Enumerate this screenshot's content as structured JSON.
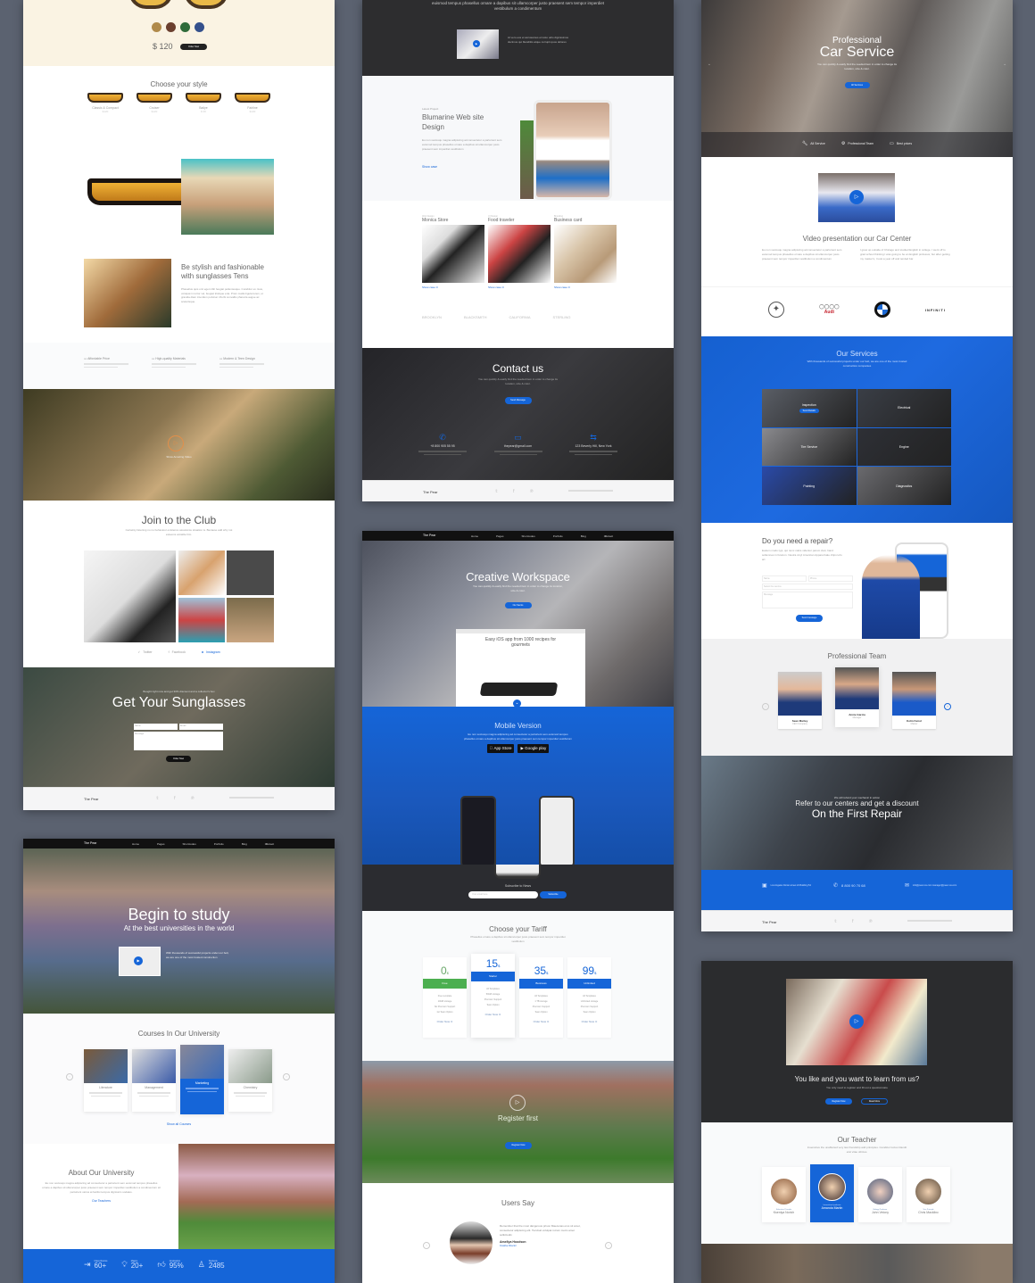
{
  "brand": "The Pear",
  "nav_items": [
    "Home",
    "Pages",
    "Shortcodes",
    "Portfolio",
    "Blog",
    "Contact"
  ],
  "sunglasses": {
    "swatch_colors": [
      "#b08a4a",
      "#6b3f2e",
      "#2f6b3a",
      "#34508c"
    ],
    "price": "$ 120",
    "order_btn": "Order Now",
    "choose_title": "Choose your style",
    "styles": [
      {
        "name": "Classic & Compact",
        "price": "$120"
      },
      {
        "name": "Cruiser",
        "price": "$120"
      },
      {
        "name": "Bailye",
        "price": "$ 95"
      },
      {
        "name": "Fairline",
        "price": "$130"
      }
    ],
    "feature_title": "Be stylish and fashionable with sunglasses Tens",
    "feature_text": "Phasellus quis orci eget nibh feugiat pellentesque. Curabitur ex risus, volutpat in tortor vel, feugiat tristique erat. Proin mattis ligula lorem, ut gravida diam interdum pulvinar. Morbi convallis pharetra augue ac scelerisque.",
    "benefits": [
      "Affordable Price",
      "High-quality Materials",
      "Modern & Teen Design"
    ],
    "video_label": "Show Amazing Video",
    "club_title": "Join to the Club",
    "club_text": "Certainty listening no no behaviour existence assurance situation is. Because add why not esteems amiable him.",
    "social": [
      "Twitter",
      "Facebook",
      "Instagram"
    ],
    "cta_pre": "Bought right now and get 30% discount and a collector's box",
    "cta_title": "Get Your Sunglasses",
    "form_name": "Name",
    "form_email": "Email",
    "form_message": "Message",
    "cta_btn": "Order Now"
  },
  "university": {
    "hero_title": "Begin to study",
    "hero_sub": "At the best universities in the world",
    "hero_text": "With thousands of successful projects under our belt, we are one of the most trusted construction",
    "courses_title": "Courses In Our University",
    "courses": [
      {
        "name": "Literature",
        "active": false
      },
      {
        "name": "Management",
        "active": false
      },
      {
        "name": "Marketing",
        "active": true
      },
      {
        "name": "Chemistry",
        "active": false
      }
    ],
    "courses_link": "Show all Courses",
    "about_title": "About Our University",
    "about_text": "Eu non sociosqu magna adipiscing ad consectetur a parturient sem euismod tempus phasellus ornare a dapibus sit ullamcorper justo praesent sem tempor imperdiet vestibulum a condimentum sit parturient varius at facilisi tempus dignissim sodales.",
    "about_link": "Our Teachers",
    "stats": [
      {
        "label": "Class Rooms",
        "value": "60+",
        "icon": "door-icon"
      },
      {
        "label": "Majors",
        "value": "20+",
        "icon": "lightbulb-icon"
      },
      {
        "label": "Graduation",
        "value": "95%",
        "icon": "thumbs-up-icon"
      },
      {
        "label": "Students",
        "value": "2485",
        "icon": "user-icon"
      }
    ]
  },
  "agency": {
    "top_text": "euismod tempus phasellus ornare a dapibus sit ullamcorper justo praesent sem tempor imperdiet vestibulum a condimentum",
    "top_video_text": "At vero eos et accusamus et iusto odio dignissimos ducimus qui blanditiis atque corrupti quos dolores",
    "latest_label": "Latest Project",
    "project_title": "Blumarine Web site Design",
    "project_text": "Eu non sociosqu magna adipiscing ad consectetur a parturient sem euismod tempus phasellus ornare a dapibus sit ullamcorper justo praesent sem imperdiet vestibulum",
    "show_case": "Show case",
    "projects": [
      {
        "cat": "Web Design",
        "title": "Monica Store"
      },
      {
        "cat": "UI Design",
        "title": "Food traveler"
      },
      {
        "cat": "Branding",
        "title": "Business card"
      }
    ],
    "clients": [
      "BROOKLYN",
      "BLACKSMITH",
      "CALIFORNIA",
      "STERLING"
    ],
    "contact_title": "Contact us",
    "contact_text": "You can quickly & easily find the needed item in order to change its location, size & color.",
    "contact_btn": "Send Message",
    "contacts": [
      {
        "icon": "phone-icon",
        "value": "+8 800 905 55 95"
      },
      {
        "icon": "chat-icon",
        "value": "thepear@gmail.com"
      },
      {
        "icon": "signpost-icon",
        "value": "123 Beverly Hill, New York"
      }
    ]
  },
  "workspace": {
    "hero_title": "Creative Workspace",
    "hero_text": "You can quickly & easily find the needed item in order to change its location, size & color.",
    "hero_btn": "Our Servis",
    "mock_title": "Easy iOS app from 1000 recipes for gourmets",
    "mobile_title": "Mobile Version",
    "mobile_text": "Eu non sociosqu magna adipiscing ad consectetur a parturient sem euismod tempus phasellus ornare a dapibus sit ullamcorper justo praesent sem tempor imperdiet vestibulum",
    "app_store": "App Store",
    "google_play": "Google play",
    "subscribe_label": "Subscribe to News",
    "subscribe_placeholder": "Your email here",
    "subscribe_btn": "Subscribe",
    "tariff_title": "Choose your Tariff",
    "tariff_text": "Phasellus ornare a dapibus sit ullamcorper justo praesent sem tempor imperdiet vestibulum",
    "plans": [
      {
        "price": "0",
        "name": "Free",
        "color": "#4caf50",
        "features": [
          "Free template",
          "10GB storage",
          "No Premium Support",
          "1st Team Option"
        ],
        "featured": false
      },
      {
        "price": "15",
        "name": "Starter",
        "color": "#1565d8",
        "features": [
          "All Templates",
          "50GB storage",
          "Premium Support",
          "Team Option"
        ],
        "featured": true
      },
      {
        "price": "35",
        "name": "Business",
        "color": "#1565d8",
        "features": [
          "All Templates",
          "1 TB storage",
          "Premium Support",
          "Team Option"
        ],
        "featured": false
      },
      {
        "price": "99",
        "name": "Unlimited",
        "color": "#1565d8",
        "features": [
          "All Templates",
          "Unlimited storage",
          "Premium Support",
          "Team Option"
        ],
        "featured": false
      }
    ],
    "order_now": "Order Now",
    "currency": "$",
    "register_title": "Register first",
    "register_btn": "Register Now",
    "users_title": "Users Say",
    "quote": "Remember that the most dangerous prison Maecenas eros sit amet, consectetur adipiscing elit. Tiervisal volutpat rutrum metro amet sollicitudin",
    "quote_author": "Amellya Hoodson",
    "quote_role": "Creative Director"
  },
  "car": {
    "hero_pre": "Professional",
    "hero_title": "Car Service",
    "hero_text": "You can quickly & easily find the needed item in order to change its location, size & color.",
    "hero_btn": "All Services",
    "features": [
      {
        "icon": "wrench-icon",
        "label": "All Service"
      },
      {
        "icon": "gear-icon",
        "label": "Professional Team"
      },
      {
        "icon": "wallet-icon",
        "label": "Best prices"
      }
    ],
    "video_title": "Video presentation our Car Center",
    "video_text_1": "Eu non sociosqu magna adipiscing ad consectetur a parturient sem euismod tempus phasellus ornare a dapibus sit ullamcorper justo praesent sem tempor imperdiet vestibulum a condimentum",
    "video_text_2": "I grew up outside of Chicago and studied English in college. I went off to grad school thinking I was going to be an English professor, but after getting my master's, I took a year off and tended bar",
    "brands": [
      "Mercedes",
      "Audi",
      "BMW",
      "INFINITI"
    ],
    "services_title": "Our Services",
    "services_text": "With thousands of successful projects under our belt, we are one of the most trusted construction companies",
    "services": [
      "Inspection",
      "Electrical",
      "Tire Service",
      "Engine",
      "Painting",
      "Diagnostics"
    ],
    "services_btn": "Send Details",
    "repair_title": "Do you need a repair?",
    "repair_text": "Eodem modo typi, qui nunc nobis videntur parum clari, hand sollemnes in futurum. Neutra vinyl American Apparel kale chips tofu art",
    "repair_name": "Name",
    "repair_phone": "Phone",
    "repair_select": "Select the service",
    "repair_message": "Message",
    "repair_btn": "Send message",
    "team_title": "Professional Team",
    "team": [
      {
        "name": "Sean Marley",
        "role": "CEO Company"
      },
      {
        "name": "Annie Garcia",
        "role": "Manager"
      },
      {
        "name": "Kolin Farrel",
        "role": "Master"
      }
    ],
    "discount_pre": "We will refund your mechanic in action",
    "discount_line": "Refer to our centers and get a discount",
    "discount_title": "On the First Repair",
    "contacts": [
      {
        "icon": "map-icon",
        "value": "Los Angeles Dorian street 24 Building 54"
      },
      {
        "icon": "phone-icon",
        "value": "8 800 90 70 68"
      },
      {
        "icon": "mail-icon",
        "value": "info@pear-rus.com manager@pear-rus.com"
      }
    ]
  },
  "school": {
    "title": "You like and you want to learn from us?",
    "sub": "You only need to register and fill out a questionnaire",
    "btn_register": "Register Now",
    "btn_read": "Read More",
    "teacher_title": "Our Teacher",
    "teacher_text": "Insensitive the unaffected very law friendship add principles. Curabitur luctus blandit erat vitae ultrices.",
    "teachers": [
      {
        "role": "Education Principle",
        "name": "Kseniya Norich",
        "active": false
      },
      {
        "role": "International professor",
        "name": "Amanda Martin",
        "active": true
      },
      {
        "role": "Biology Professor",
        "name": "John Velony",
        "active": false
      },
      {
        "role": "Vice Principle",
        "name": "Chris Macklinc",
        "active": false
      }
    ]
  }
}
